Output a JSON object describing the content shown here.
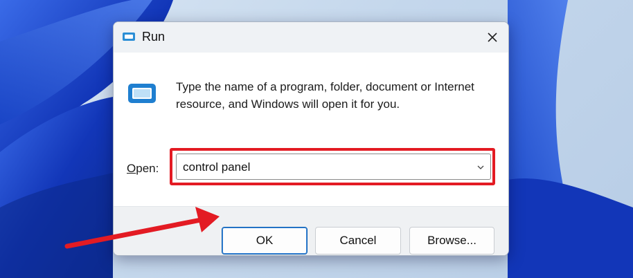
{
  "window": {
    "title": "Run",
    "close_icon": "close-icon"
  },
  "content": {
    "description": "Type the name of a program, folder, document or Internet resource, and Windows will open it for you.",
    "open_label": "Open:",
    "open_value": "control panel"
  },
  "buttons": {
    "ok": "OK",
    "cancel": "Cancel",
    "browse": "Browse..."
  },
  "annotations": {
    "highlight_color": "#e31b23",
    "arrow_color": "#e31b23"
  },
  "colors": {
    "accent": "#0b5fb3",
    "wallpaper_blue": "#1a47c8"
  }
}
